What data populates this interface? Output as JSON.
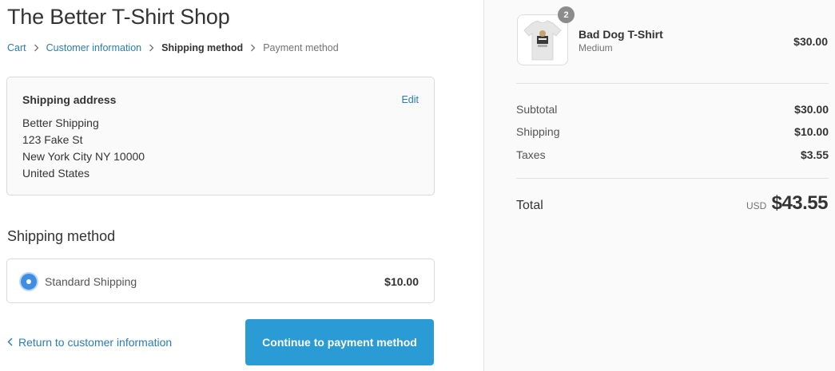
{
  "shop": {
    "title": "The Better T-Shirt Shop"
  },
  "breadcrumb": {
    "cart": "Cart",
    "customer_information": "Customer information",
    "shipping_method": "Shipping method",
    "payment_method": "Payment method"
  },
  "shipping_address": {
    "heading": "Shipping address",
    "edit_label": "Edit",
    "lines": [
      "Better Shipping",
      "123 Fake St",
      "New York City NY 10000",
      "United States"
    ]
  },
  "shipping_method": {
    "heading": "Shipping method",
    "option_label": "Standard Shipping",
    "option_price": "$10.00",
    "selected": true
  },
  "actions": {
    "return_label": "Return to customer information",
    "continue_label": "Continue to payment method"
  },
  "order": {
    "product": {
      "name": "Bad Dog T-Shirt",
      "variant": "Medium",
      "price": "$30.00",
      "quantity": "2"
    },
    "subtotal_label": "Subtotal",
    "subtotal_value": "$30.00",
    "shipping_label": "Shipping",
    "shipping_value": "$10.00",
    "taxes_label": "Taxes",
    "taxes_value": "$3.55",
    "total_label": "Total",
    "total_currency": "USD",
    "total_value": "$43.55"
  },
  "colors": {
    "link": "#2a7cb5",
    "button": "#2a9bd4",
    "radio": "#3f8ee4",
    "sidebar_bg": "#fafafa"
  },
  "icons": [
    "chevron-right-icon",
    "chevron-left-icon",
    "radio-selected-icon",
    "tshirt-product-image"
  ]
}
